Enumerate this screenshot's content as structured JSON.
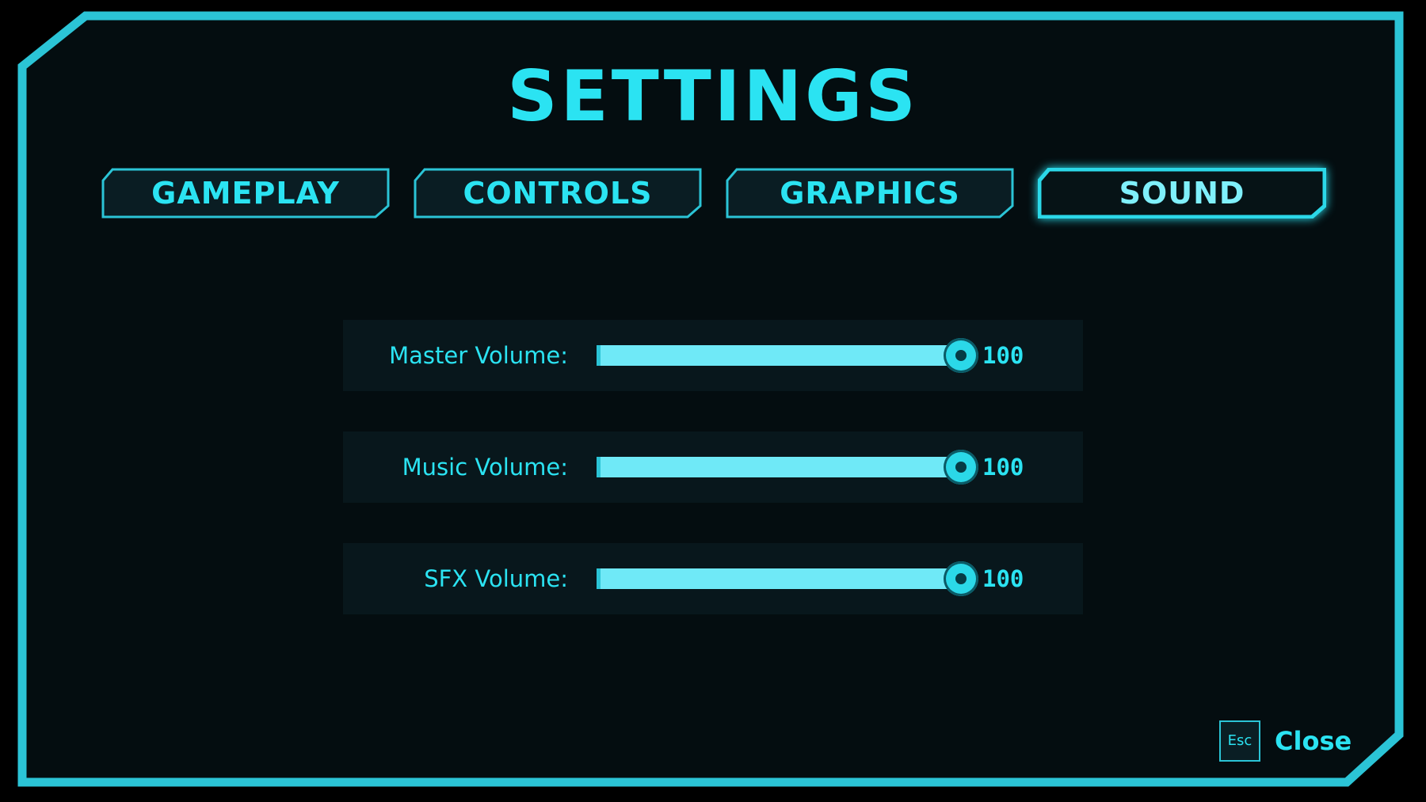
{
  "title": "SETTINGS",
  "tabs": [
    {
      "label": "GAMEPLAY",
      "active": false
    },
    {
      "label": "CONTROLS",
      "active": false
    },
    {
      "label": "GRAPHICS",
      "active": false
    },
    {
      "label": "SOUND",
      "active": true
    }
  ],
  "sound": {
    "master": {
      "label": "Master Volume:",
      "value": "100",
      "level": 100
    },
    "music": {
      "label": "Music Volume:",
      "value": "100",
      "level": 100
    },
    "sfx": {
      "label": "SFX Volume:",
      "value": "100",
      "level": 100
    }
  },
  "footer": {
    "esc_key": "Esc",
    "close_label": "Close"
  },
  "colors": {
    "accent": "#2be3f2",
    "background": "#040d10",
    "row_background": "#08171c"
  }
}
